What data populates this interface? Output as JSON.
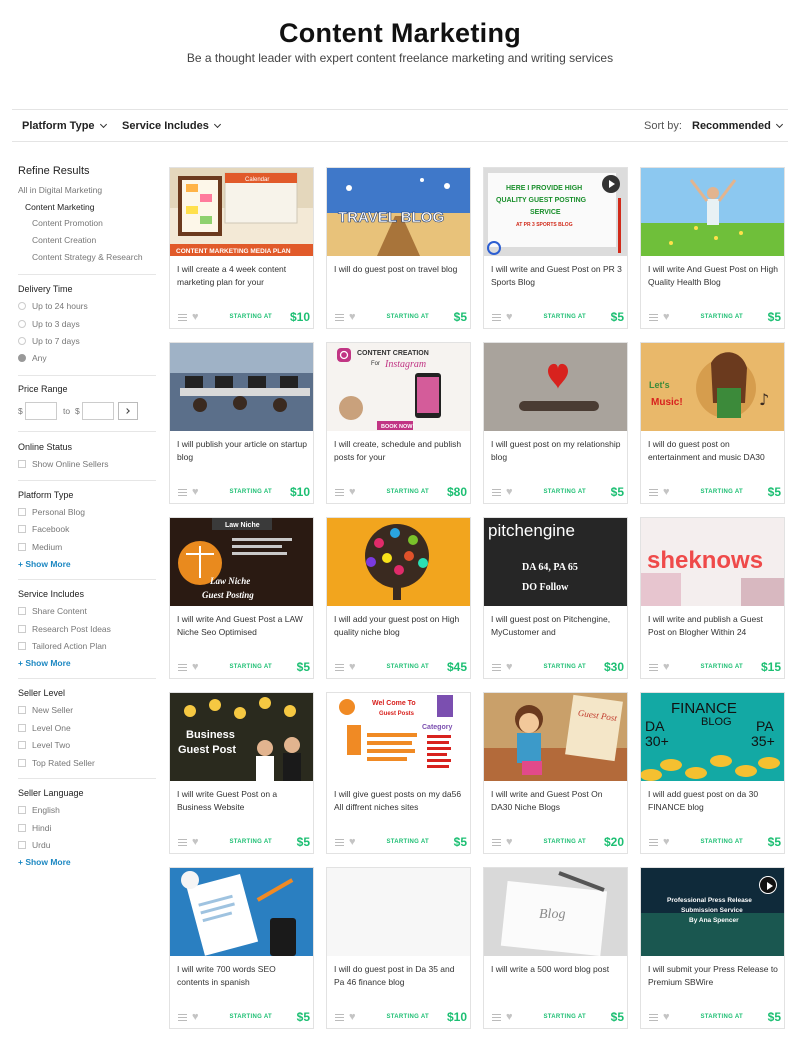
{
  "header": {
    "title": "Content Marketing",
    "subtitle": "Be a thought leader with expert content freelance marketing and writing services"
  },
  "filterbar": {
    "platform_type": "Platform Type",
    "service_includes": "Service Includes",
    "sort_label": "Sort by:",
    "sort_value": "Recommended"
  },
  "sidebar": {
    "refine_title": "Refine Results",
    "category_root": "All in Digital Marketing",
    "category_current": "Content Marketing",
    "subcategories": [
      "Content Promotion",
      "Content Creation",
      "Content Strategy & Research"
    ],
    "delivery": {
      "title": "Delivery Time",
      "options": [
        "Up to 24 hours",
        "Up to 3 days",
        "Up to 7 days",
        "Any"
      ],
      "selected": "Any"
    },
    "price_range": {
      "title": "Price Range",
      "currency": "$",
      "to": "to"
    },
    "online_status": {
      "title": "Online Status",
      "option": "Show Online Sellers"
    },
    "platform_type": {
      "title": "Platform Type",
      "options": [
        "Personal Blog",
        "Facebook",
        "Medium"
      ],
      "show_more": "+ Show More"
    },
    "service_includes": {
      "title": "Service Includes",
      "options": [
        "Share Content",
        "Research Post Ideas",
        "Tailored Action Plan"
      ],
      "show_more": "+ Show More"
    },
    "seller_level": {
      "title": "Seller Level",
      "options": [
        "New Seller",
        "Level One",
        "Level Two",
        "Top Rated Seller"
      ]
    },
    "seller_language": {
      "title": "Seller Language",
      "options": [
        "English",
        "Hindi",
        "Urdu"
      ],
      "show_more": "+ Show More"
    }
  },
  "starting_at": "STARTING AT",
  "gigs": [
    {
      "title": "I will create a 4 week content marketing plan for your",
      "price": "$10",
      "thumb_text": [
        "Calendar",
        "CONTENT MARKETING MEDIA PLAN"
      ]
    },
    {
      "title": "I will do guest post on travel blog",
      "price": "$5",
      "thumb_text": [
        "TRAVEL BLOG"
      ]
    },
    {
      "title": "I will write and Guest Post on PR 3 Sports Blog",
      "price": "$5",
      "thumb_text": [
        "HERE I PROVIDE HIGH",
        "QUALITY GUEST POSTING",
        "SERVICE",
        "AT PR 3 SPORTS BLOG"
      ]
    },
    {
      "title": "I will write And Guest Post on High Quality Health Blog",
      "price": "$5",
      "thumb_text": []
    },
    {
      "title": "I will publish your article on startup blog",
      "price": "$10",
      "thumb_text": []
    },
    {
      "title": "I will create, schedule and publish posts for your",
      "price": "$80",
      "thumb_text": [
        "CONTENT CREATION",
        "For",
        "Instagram",
        "BOOK NOW!"
      ]
    },
    {
      "title": "I will guest post on my relationship blog",
      "price": "$5",
      "thumb_text": []
    },
    {
      "title": "I will do guest post on entertainment and music DA30",
      "price": "$5",
      "thumb_text": [
        "Let's",
        "Music!"
      ]
    },
    {
      "title": "I will write And Guest Post a LAW Niche Seo Optimised",
      "price": "$5",
      "thumb_text": [
        "Law Niche",
        "Law Niche",
        "Guest Posting"
      ]
    },
    {
      "title": "I will add your guest post on High quality niche blog",
      "price": "$45",
      "thumb_text": []
    },
    {
      "title": "I will guest post on Pitchengine, MyCustomer and",
      "price": "$30",
      "thumb_text": [
        "pitchengine",
        "DA 64, PA 65",
        "DO Follow"
      ]
    },
    {
      "title": "I will write and publish a Guest Post on Blogher Within 24",
      "price": "$15",
      "thumb_text": [
        "sheknows"
      ]
    },
    {
      "title": "I will write Guest Post on a Business Website",
      "price": "$5",
      "thumb_text": [
        "Business",
        "Guest Post"
      ]
    },
    {
      "title": "I will give guest posts on my da56 All diffrent niches sites",
      "price": "$5",
      "thumb_text": [
        "Wel Come To",
        "Guest Posts",
        "Category"
      ]
    },
    {
      "title": "I will write and Guest Post On DA30 Niche Blogs",
      "price": "$20",
      "thumb_text": [
        "Guest Post"
      ]
    },
    {
      "title": "I will add guest post on da 30 FINANCE blog",
      "price": "$5",
      "thumb_text": [
        "FINANCE",
        "BLOG",
        "DA",
        "30+",
        "PA",
        "35+"
      ]
    },
    {
      "title": "I will write 700 words SEO contents in spanish",
      "price": "$5",
      "thumb_text": []
    },
    {
      "title": "I will do guest post in Da 35 and Pa 46 finance blog",
      "price": "$10",
      "thumb_text": []
    },
    {
      "title": "I will write a 500 word blog post",
      "price": "$5",
      "thumb_text": [
        "Blog"
      ]
    },
    {
      "title": "I will submit your Press Release to Premium SBWire",
      "price": "$5",
      "thumb_text": [
        "Professional Press Release",
        "Submission Service",
        "By Ana Spencer"
      ]
    }
  ]
}
